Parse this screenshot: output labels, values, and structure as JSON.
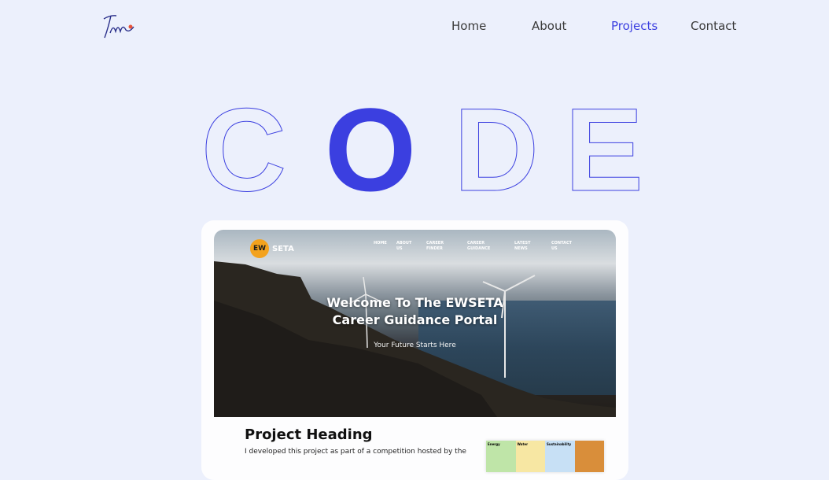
{
  "nav": {
    "items": [
      {
        "label": "Home",
        "active": false
      },
      {
        "label": "About",
        "active": false
      },
      {
        "label": "Projects",
        "active": true
      },
      {
        "label": "Contact",
        "active": false
      }
    ],
    "active_color": "#3b3fe0",
    "text_color": "#3a3a3a"
  },
  "hero": {
    "letters": [
      "C",
      "O",
      "D",
      "E"
    ],
    "filled_letter_index": 1,
    "accent_color": "#3b3fe0"
  },
  "project": {
    "screenshot": {
      "logo_text": "SETA",
      "logo_badge": "EW",
      "nav": [
        "HOME",
        "ABOUT US",
        "CAREER FINDER",
        "CAREER GUIDANCE",
        "LATEST NEWS",
        "CONTACT US"
      ],
      "title_line1": "Welcome To The EWSETA",
      "title_line2": "Career Guidance Portal",
      "subtitle": "Your Future Starts Here"
    },
    "heading": "Project Heading",
    "description": "I developed this project as part of a competition hosted by the",
    "thumb_labels": [
      "Energy",
      "Water",
      "Sustainability"
    ]
  },
  "icons": {
    "logo": "tm-signature-logo"
  }
}
